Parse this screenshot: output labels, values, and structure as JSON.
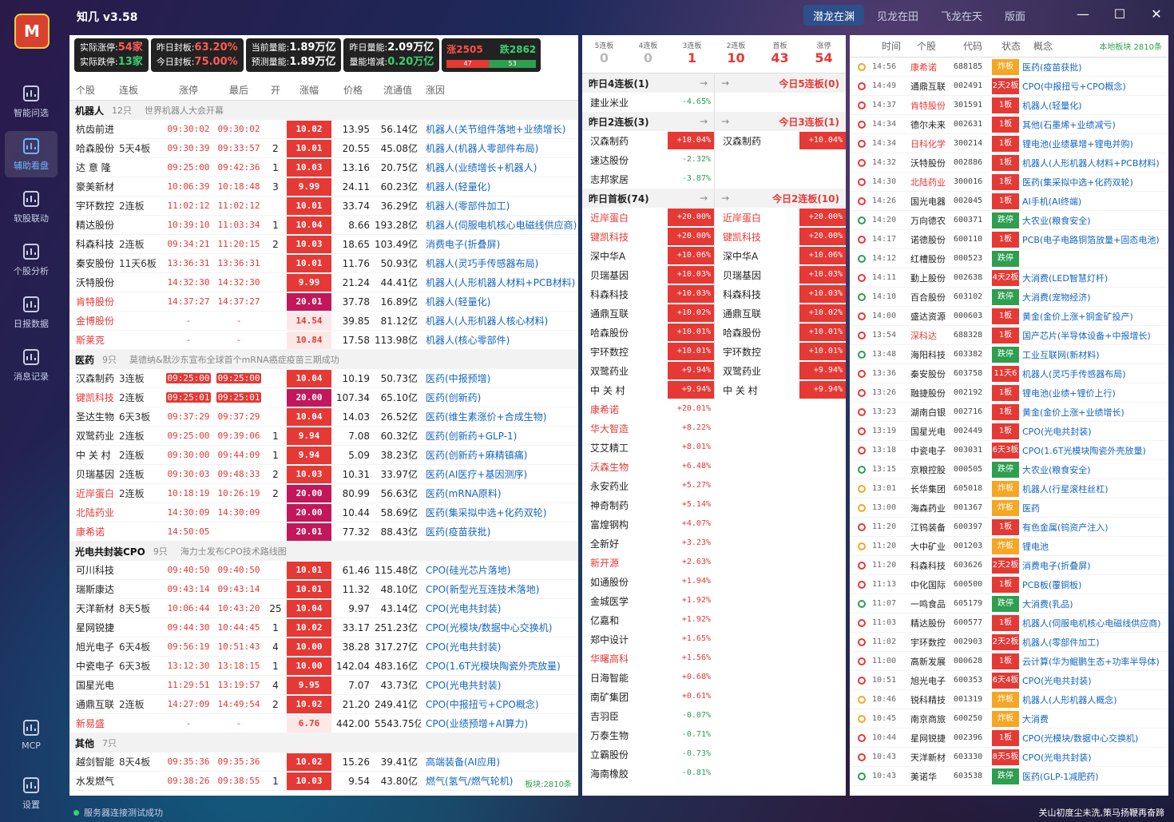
{
  "app": {
    "title": "知几 v3.58",
    "logo": "M"
  },
  "nav": [
    {
      "label": "智能问选"
    },
    {
      "label": "辅助看盘"
    },
    {
      "label": "软股联动"
    },
    {
      "label": "个股分析"
    },
    {
      "label": "日报数据"
    },
    {
      "label": "消息记录"
    },
    {
      "label": "MCP"
    },
    {
      "label": "设置"
    }
  ],
  "tabs": [
    "潜龙在渊",
    "见龙在田",
    "飞龙在天",
    "版面"
  ],
  "stats": {
    "zt_l": "实际涨停:",
    "zt_v": "54家",
    "dt_l": "实际跌停:",
    "dt_v": "13家",
    "yzt_l": "昨日封板:",
    "yzt_v": "63.20%",
    "tzt_l": "今日封板:",
    "tzt_v": "75.00%",
    "cur_l": "当前量能:",
    "cur_v": "1.89万亿",
    "pre_l": "预测量能:",
    "pre_v": "1.89万亿",
    "y_l": "昨日量能:",
    "y_v": "2.09万亿",
    "inc_l": "量能增减:",
    "inc_v": "0.20万亿",
    "up": "涨2505",
    "down": "跌2862",
    "up_n": "47",
    "down_n": "53"
  },
  "cols": [
    "个股",
    "连板",
    "涨停",
    "最后",
    "开",
    "涨幅",
    "价格",
    "流通值",
    "涨因"
  ],
  "groups": [
    {
      "name": "机器人",
      "count": "12只",
      "desc": "世界机器人大会开幕",
      "rows": [
        [
          "杭齿前进",
          "",
          "09:30:02",
          "09:30:02",
          "",
          "10.02",
          "13.95",
          "56.14亿",
          "机器人(关节组件落地+业绩增长)",
          ""
        ],
        [
          "哈森股份",
          "5天4板",
          "09:30:39",
          "09:33:57",
          "2",
          "10.01",
          "20.55",
          "45.08亿",
          "机器人(机器人零部件布局)",
          ""
        ],
        [
          "达 意 隆",
          "",
          "09:25:00",
          "09:42:36",
          "1",
          "10.03",
          "13.16",
          "20.75亿",
          "机器人(业绩增长+机器人)",
          ""
        ],
        [
          "豪美新材",
          "",
          "10:06:39",
          "10:18:48",
          "3",
          "9.99",
          "24.11",
          "60.23亿",
          "机器人(轻量化)",
          ""
        ],
        [
          "宇环数控",
          "2连板",
          "11:02:12",
          "11:02:12",
          "",
          "10.01",
          "33.74",
          "36.29亿",
          "机器人(零部件加工)",
          ""
        ],
        [
          "精达股份",
          "",
          "10:39:10",
          "11:03:34",
          "1",
          "10.04",
          "8.66",
          "193.28亿",
          "机器人(伺服电机核心电磁线供应商)",
          ""
        ],
        [
          "科森科技",
          "2连板",
          "09:34:21",
          "11:20:15",
          "2",
          "10.03",
          "18.65",
          "103.49亿",
          "消费电子(折叠屏)",
          ""
        ],
        [
          "秦安股份",
          "11天6板",
          "13:36:31",
          "13:36:31",
          "",
          "10.01",
          "11.76",
          "50.93亿",
          "机器人(灵巧手传感器布局)",
          ""
        ],
        [
          "沃特股份",
          "",
          "14:32:30",
          "14:32:30",
          "",
          "9.99",
          "21.24",
          "44.41亿",
          "机器人(人形机器人材料+PCB材料)",
          ""
        ],
        [
          "肯特股份",
          "",
          "14:37:27",
          "14:37:27",
          "",
          "20.01",
          "37.78",
          "16.89亿",
          "机器人(轻量化)",
          "r"
        ],
        [
          "金博股份",
          "",
          "-",
          "-",
          "",
          "14.54",
          "39.85",
          "81.12亿",
          "机器人(人形机器人核心材料)",
          "rl"
        ],
        [
          "斯莱克",
          "",
          "-",
          "-",
          "",
          "10.84",
          "17.58",
          "113.98亿",
          "机器人(核心零部件)",
          "rl"
        ]
      ]
    },
    {
      "name": "医药",
      "count": "9只",
      "desc": "莫德纳&默沙东宣布全球首个mRNA癌症疫苗三期成功",
      "rows": [
        [
          "汉森制药",
          "3连板",
          "09:25:00",
          "09:25:00",
          "",
          "10.04",
          "10.19",
          "50.73亿",
          "医药(中报预增)",
          "h"
        ],
        [
          "键凯科技",
          "2连板",
          "09:25:01",
          "09:25:01",
          "",
          "20.00",
          "107.34",
          "65.10亿",
          "医药(创新药)",
          "rh"
        ],
        [
          "圣达生物",
          "6天3板",
          "09:37:29",
          "09:37:29",
          "",
          "10.04",
          "14.03",
          "26.52亿",
          "医药(维生素涨价+合成生物)",
          ""
        ],
        [
          "双鹭药业",
          "2连板",
          "09:25:00",
          "09:39:06",
          "1",
          "9.94",
          "7.08",
          "60.32亿",
          "医药(创新药+GLP-1)",
          ""
        ],
        [
          "中 关 村",
          "2连板",
          "09:30:00",
          "09:44:09",
          "1",
          "9.94",
          "5.09",
          "38.23亿",
          "医药(创新药+麻精镇痛)",
          ""
        ],
        [
          "贝瑞基因",
          "2连板",
          "09:30:03",
          "09:48:33",
          "2",
          "10.03",
          "10.31",
          "33.97亿",
          "医药(AI医疗+基因测序)",
          ""
        ],
        [
          "近岸蛋白",
          "2连板",
          "10:18:19",
          "10:26:19",
          "2",
          "20.00",
          "80.99",
          "56.63亿",
          "医药(mRNA原料)",
          "r"
        ],
        [
          "北陆药业",
          "",
          "14:30:09",
          "14:30:09",
          "",
          "20.00",
          "10.44",
          "58.69亿",
          "医药(集采拟中选+化药双轮)",
          "r"
        ],
        [
          "康希诺",
          "",
          "14:50:05",
          "",
          "",
          "20.01",
          "77.32",
          "88.43亿",
          "医药(疫苗获批)",
          "r"
        ]
      ]
    },
    {
      "name": "光电共封装CPO",
      "count": "9只",
      "desc": "海力士发布CPO技术路线图",
      "rows": [
        [
          "可川科技",
          "",
          "09:40:50",
          "09:40:50",
          "",
          "10.01",
          "61.46",
          "115.48亿",
          "CPO(硅光芯片落地)",
          ""
        ],
        [
          "瑞斯康达",
          "",
          "09:43:14",
          "09:43:14",
          "",
          "10.01",
          "11.32",
          "48.10亿",
          "CPO(新型光互连技术落地)",
          ""
        ],
        [
          "天洋新材",
          "8天5板",
          "10:06:44",
          "10:43:20",
          "25",
          "10.04",
          "9.97",
          "43.14亿",
          "CPO(光电共封装)",
          ""
        ],
        [
          "星网锐捷",
          "",
          "09:44:30",
          "10:44:45",
          "1",
          "10.02",
          "33.17",
          "251.23亿",
          "CPO(光模块/数据中心交换机)",
          ""
        ],
        [
          "旭光电子",
          "6天4板",
          "09:56:19",
          "10:51:43",
          "4",
          "10.00",
          "38.28",
          "317.27亿",
          "CPO(光电共封装)",
          ""
        ],
        [
          "中瓷电子",
          "6天3板",
          "13:12:30",
          "13:18:15",
          "1",
          "10.00",
          "142.04",
          "483.16亿",
          "CPO(1.6T光模块陶瓷外壳放量)",
          ""
        ],
        [
          "国星光电",
          "",
          "11:29:51",
          "13:19:57",
          "4",
          "9.95",
          "7.07",
          "43.73亿",
          "CPO(光电共封装)",
          ""
        ],
        [
          "通鼎互联",
          "2连板",
          "14:27:09",
          "14:49:54",
          "2",
          "10.02",
          "21.20",
          "249.41亿",
          "CPO(中报扭亏+CPO概念)",
          ""
        ],
        [
          "新易盛",
          "",
          "-",
          "-",
          "",
          "6.76",
          "442.00",
          "5543.75亿",
          "CPO(业绩预增+AI算力)",
          "rl"
        ]
      ]
    },
    {
      "name": "其他",
      "count": "7只",
      "desc": "",
      "rows": [
        [
          "越剑智能",
          "8天4板",
          "09:35:36",
          "09:35:36",
          "",
          "10.02",
          "15.26",
          "39.41亿",
          "高端装备(AI应用)",
          ""
        ],
        [
          "水发燃气",
          "",
          "09:38:26",
          "09:38:55",
          "1",
          "10.03",
          "9.54",
          "43.80亿",
          "燃气(氢气/燃气轮机)",
          ""
        ]
      ]
    }
  ],
  "board_note": "板块:2810条",
  "ladder": {
    "top": [
      {
        "l": "5连板",
        "v": "0"
      },
      {
        "l": "4连板",
        "v": "0"
      },
      {
        "l": "3连板",
        "v": "1"
      },
      {
        "l": "2连板",
        "v": "10"
      },
      {
        "l": "首板",
        "v": "43"
      },
      {
        "l": "涨停",
        "v": "54"
      }
    ],
    "left": [
      {
        "h": "昨日4连板(1)",
        "rows": [
          [
            "建业米业",
            "-4.65%",
            "m"
          ]
        ]
      },
      {
        "h": "昨日2连板(3)",
        "rows": [
          [
            "汉森制药",
            "+10.04%",
            "s"
          ],
          [
            "速达股份",
            "-2.32%",
            "m"
          ],
          [
            "志邦家居",
            "-3.87%",
            "m"
          ]
        ]
      },
      {
        "h": "昨日首板(74)",
        "rows": [
          [
            "近岸蛋白",
            "+20.00%",
            "s",
            "r"
          ],
          [
            "键凯科技",
            "+20.00%",
            "s",
            "r"
          ],
          [
            "深中华A",
            "+10.06%",
            "s"
          ],
          [
            "贝瑞基因",
            "+10.03%",
            "s"
          ],
          [
            "科森科技",
            "+10.03%",
            "s"
          ],
          [
            "通鼎互联",
            "+10.02%",
            "s"
          ],
          [
            "哈森股份",
            "+10.01%",
            "s"
          ],
          [
            "宇环数控",
            "+10.01%",
            "s"
          ],
          [
            "双鹭药业",
            "+9.94%",
            "s"
          ],
          [
            "中 关 村",
            "+9.94%",
            "s"
          ],
          [
            "康希诺",
            "+20.01%",
            "p",
            "r"
          ],
          [
            "华大智造",
            "+8.22%",
            "p",
            "r"
          ],
          [
            "艾艾精工",
            "+8.01%",
            "p"
          ],
          [
            "沃森生物",
            "+6.48%",
            "p",
            "r"
          ],
          [
            "永安药业",
            "+5.27%",
            "p"
          ],
          [
            "神奇制药",
            "+5.14%",
            "p"
          ],
          [
            "富煌钢构",
            "+4.07%",
            "p"
          ],
          [
            "全新好",
            "+3.23%",
            "p"
          ],
          [
            "新开源",
            "+2.63%",
            "p",
            "r"
          ],
          [
            "如通股份",
            "+1.94%",
            "p"
          ],
          [
            "金城医学",
            "+1.92%",
            "p"
          ],
          [
            "亿嘉和",
            "+1.92%",
            "p"
          ],
          [
            "郑中设计",
            "+1.65%",
            "p"
          ],
          [
            "华曙高科",
            "+1.56%",
            "p",
            "r"
          ],
          [
            "日海智能",
            "+0.68%",
            "p"
          ],
          [
            "南矿集团",
            "+0.61%",
            "p"
          ],
          [
            "吉羽臣",
            "-0.07%",
            "m"
          ],
          [
            "万泰生物",
            "-0.71%",
            "m"
          ],
          [
            "立霸股份",
            "-0.73%",
            "m"
          ],
          [
            "海南橡胶",
            "-0.81%",
            "m"
          ]
        ]
      }
    ],
    "right": [
      {
        "h": "今日5连板(0)",
        "rows": []
      },
      {
        "h": "今日3连板(1)",
        "rows": [
          [
            "汉森制药",
            "+10.04%",
            "s"
          ]
        ]
      },
      {
        "h": "今日2连板(10)",
        "rows": [
          [
            "近岸蛋白",
            "+20.00%",
            "s",
            "r"
          ],
          [
            "键凯科技",
            "+20.00%",
            "s",
            "r"
          ],
          [
            "深中华A",
            "+10.06%",
            "s"
          ],
          [
            "贝瑞基因",
            "+10.03%",
            "s"
          ],
          [
            "科森科技",
            "+10.03%",
            "s"
          ],
          [
            "通鼎互联",
            "+10.02%",
            "s"
          ],
          [
            "哈森股份",
            "+10.01%",
            "s"
          ],
          [
            "宇环数控",
            "+10.01%",
            "s"
          ],
          [
            "双鹭药业",
            "+9.94%",
            "s"
          ],
          [
            "中 关 村",
            "+9.94%",
            "s"
          ]
        ]
      }
    ]
  },
  "feed": {
    "cols": [
      "时间",
      "个股",
      "代码",
      "状态",
      "概念"
    ],
    "note": "本地板块 2810条",
    "rows": [
      [
        "14:56",
        "康希诺",
        "688185",
        "炸板",
        "医药(疫苗获批)",
        "y",
        "r"
      ],
      [
        "14:49",
        "通鼎互联",
        "002491",
        "2天2板",
        "CPO(中报扭亏+CPO概念)",
        "r",
        ""
      ],
      [
        "14:37",
        "肯特股份",
        "301591",
        "1板",
        "机器人(轻量化)",
        "r",
        "r"
      ],
      [
        "14:34",
        "德尔未来",
        "002631",
        "1板",
        "其他(石墨烯+业绩减亏)",
        "r",
        ""
      ],
      [
        "14:34",
        "日科化学",
        "300214",
        "1板",
        "锂电池(业绩暴增+锂电并购)",
        "r",
        "r"
      ],
      [
        "14:32",
        "沃特股份",
        "002886",
        "1板",
        "机器人(人形机器人材料+PCB材料)",
        "r",
        ""
      ],
      [
        "14:30",
        "北陆药业",
        "300016",
        "1板",
        "医药(集采拟中选+化药双轮)",
        "r",
        "r"
      ],
      [
        "14:26",
        "国光电器",
        "002045",
        "1板",
        "AI手机(AI终端)",
        "r",
        ""
      ],
      [
        "14:20",
        "万向德农",
        "600371",
        "跌停",
        "大农业(粮食安全)",
        "g",
        ""
      ],
      [
        "14:17",
        "诺德股份",
        "600110",
        "1板",
        "PCB(电子电路铜箔放量+固态电池)",
        "r",
        ""
      ],
      [
        "14:12",
        "红槽股份",
        "000523",
        "跌停",
        "",
        "g",
        ""
      ],
      [
        "14:11",
        "勤上股份",
        "002638",
        "4天2板",
        "大消费(LED智慧灯杆)",
        "r",
        ""
      ],
      [
        "14:10",
        "百合股份",
        "603102",
        "跌停",
        "大消费(宠物经济)",
        "g",
        ""
      ],
      [
        "14:00",
        "盛达资源",
        "000603",
        "1板",
        "黄金(金价上涨+铜金矿投产)",
        "r",
        ""
      ],
      [
        "13:54",
        "深科达",
        "688328",
        "1板",
        "国产芯片(半导体设备+中报增长)",
        "r",
        "r"
      ],
      [
        "13:48",
        "海阳科技",
        "603382",
        "跌停",
        "工业互联网(新材料)",
        "g",
        ""
      ],
      [
        "13:36",
        "秦安股份",
        "603758",
        "11天6板",
        "机器人(灵巧手传感器布局)",
        "r",
        ""
      ],
      [
        "13:26",
        "融捷股份",
        "002192",
        "1板",
        "锂电池(业绩+锂价上行)",
        "r",
        ""
      ],
      [
        "13:23",
        "湖南白银",
        "002716",
        "1板",
        "黄金(金价上涨+业绩增长)",
        "r",
        ""
      ],
      [
        "13:19",
        "国星光电",
        "002449",
        "1板",
        "CPO(光电共封装)",
        "r",
        ""
      ],
      [
        "13:18",
        "中瓷电子",
        "003031",
        "6天3板",
        "CPO(1.6T光模块陶瓷外壳放量)",
        "r",
        ""
      ],
      [
        "13:15",
        "京粮控股",
        "000505",
        "跌停",
        "大农业(粮食安全)",
        "g",
        ""
      ],
      [
        "13:01",
        "长华集团",
        "605018",
        "炸板",
        "机器人(行星滚柱丝杠)",
        "y",
        ""
      ],
      [
        "13:00",
        "海森药业",
        "001367",
        "炸板",
        "医药",
        "y",
        ""
      ],
      [
        "11:20",
        "江钨装备",
        "600397",
        "1板",
        "有色金属(钨资产注入)",
        "r",
        ""
      ],
      [
        "11:20",
        "大中矿业",
        "001203",
        "炸板",
        "锂电池",
        "y",
        ""
      ],
      [
        "11:20",
        "科森科技",
        "603626",
        "2天2板",
        "消费电子(折叠屏)",
        "r",
        ""
      ],
      [
        "11:13",
        "中化国际",
        "600500",
        "1板",
        "PCB板(覆铜板)",
        "r",
        ""
      ],
      [
        "11:07",
        "一鸣食品",
        "605179",
        "跌停",
        "大消费(乳品)",
        "g",
        ""
      ],
      [
        "11:03",
        "精达股份",
        "600577",
        "1板",
        "机器人(伺服电机核心电磁线供应商)",
        "r",
        ""
      ],
      [
        "11:02",
        "宇环数控",
        "002903",
        "2天2板",
        "机器人(零部件加工)",
        "r",
        ""
      ],
      [
        "11:00",
        "高新发展",
        "000628",
        "1板",
        "云计算(华为鲲鹏生态+功率半导体)",
        "r",
        ""
      ],
      [
        "10:51",
        "旭光电子",
        "600353",
        "6天4板",
        "CPO(光电共封装)",
        "r",
        ""
      ],
      [
        "10:46",
        "锐科精技",
        "001319",
        "炸板",
        "机器人(人形机器人概念)",
        "y",
        ""
      ],
      [
        "10:45",
        "南京商旅",
        "600250",
        "炸板",
        "大消费",
        "y",
        ""
      ],
      [
        "10:44",
        "星网锐捷",
        "002396",
        "1板",
        "CPO(光模块/数据中心交换机)",
        "r",
        ""
      ],
      [
        "10:43",
        "天洋新材",
        "603330",
        "8天5板",
        "CPO(光电共封装)",
        "r",
        ""
      ],
      [
        "10:43",
        "美诺华",
        "603538",
        "跌停",
        "医药(GLP-1减肥药)",
        "g",
        ""
      ]
    ]
  },
  "status": {
    "left": "服务器连接测试成功",
    "right": "关山初度尘未洗,策马扬鞭再奋蹄"
  }
}
